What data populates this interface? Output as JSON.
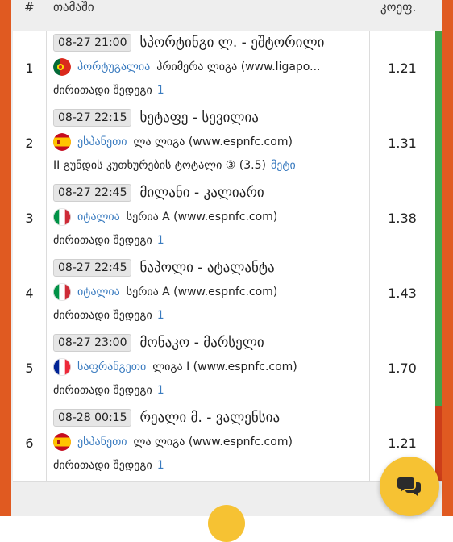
{
  "header": {
    "num": "#",
    "game": "თამაში",
    "odds": "კოეფ."
  },
  "rows": [
    {
      "num": "1",
      "time": "08-27 21:00",
      "match": "სპორტინგი ლ. - ეშტორილი",
      "country": "პორტუგალია",
      "league": "პრიმერა ლიგა (www.ligapo...",
      "market": "ძირითადი შედეგი",
      "count": "1",
      "odds": "1.21",
      "flag": "pt",
      "stripe": "green"
    },
    {
      "num": "2",
      "time": "08-27 22:15",
      "match": "ხეტაფე - სევილია",
      "country": "ესპანეთი",
      "league": "ლა ლიგა (www.espnfc.com)",
      "market": "II გუნდის კუთხურების ტოტალი ③ (3.5)",
      "count": "მეტი",
      "odds": "1.31",
      "flag": "es",
      "stripe": "green"
    },
    {
      "num": "3",
      "time": "08-27 22:45",
      "match": "მილანი - კალიარი",
      "country": "იტალია",
      "league": "სერია A (www.espnfc.com)",
      "market": "ძირითადი შედეგი",
      "count": "1",
      "odds": "1.38",
      "flag": "it",
      "stripe": "green"
    },
    {
      "num": "4",
      "time": "08-27 22:45",
      "match": "ნაპოლი - ატალანტა",
      "country": "იტალია",
      "league": "სერია A (www.espnfc.com)",
      "market": "ძირითადი შედეგი",
      "count": "1",
      "odds": "1.43",
      "flag": "it",
      "stripe": "green"
    },
    {
      "num": "5",
      "time": "08-27 23:00",
      "match": "მონაკო - მარსელი",
      "country": "საფრანგეთი",
      "league": "ლიგა I (www.espnfc.com)",
      "market": "ძირითადი შედეგი",
      "count": "1",
      "odds": "1.70",
      "flag": "fr",
      "stripe": "green"
    },
    {
      "num": "6",
      "time": "08-28 00:15",
      "match": "რეალი მ. - ვალენსია",
      "country": "ესპანეთი",
      "league": "ლა ლიგა (www.espnfc.com)",
      "market": "ძირითადი შედეგი",
      "count": "1",
      "odds": "1.21",
      "flag": "es",
      "stripe": "red"
    }
  ],
  "colors": {
    "frame": "#e05a21",
    "win": "#42a24a",
    "loss": "#cd3e1a",
    "link": "#3a7bbf",
    "fab": "#f6c233"
  },
  "icons": {
    "chat": "chat-bubbles-icon"
  }
}
